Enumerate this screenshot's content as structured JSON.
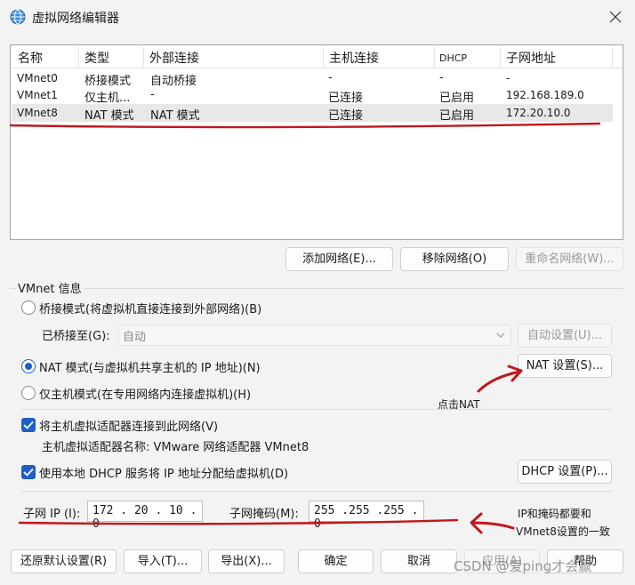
{
  "window": {
    "title": "虚拟网络编辑器",
    "icon": "network-globe-icon",
    "close_icon": "close-icon"
  },
  "table": {
    "columns": [
      "名称",
      "类型",
      "外部连接",
      "主机连接",
      "DHCP",
      "子网地址"
    ],
    "rows": [
      {
        "name": "VMnet0",
        "type": "桥接模式",
        "external": "自动桥接",
        "host": "-",
        "dhcp": "-",
        "subnet": "-"
      },
      {
        "name": "VMnet1",
        "type": "仅主机...",
        "external": "-",
        "host": "已连接",
        "dhcp": "已启用",
        "subnet": "192.168.189.0"
      },
      {
        "name": "VMnet8",
        "type": "NAT 模式",
        "external": "NAT 模式",
        "host": "已连接",
        "dhcp": "已启用",
        "subnet": "172.20.10.0"
      }
    ],
    "selected_row": "VMnet8"
  },
  "network_buttons": {
    "add": "添加网络(E)...",
    "remove": "移除网络(O)",
    "rename": "重命名网络(W)..."
  },
  "vmnet_info": {
    "group_label": "VMnet 信息",
    "bridge_radio": "桥接模式(将虚拟机直接连接到外部网络)(B)",
    "bridged_to_label": "已桥接至(G):",
    "bridged_to_value": "自动",
    "auto_settings": "自动设置(U)...",
    "nat_radio": "NAT 模式(与虚拟机共享主机的 IP 地址)(N)",
    "nat_settings": "NAT 设置(S)...",
    "host_only_radio": "仅主机模式(在专用网络内连接虚拟机)(H)",
    "selected_mode": "nat",
    "connect_adapter": "将主机虚拟适配器连接到此网络(V)",
    "connect_adapter_checked": true,
    "adapter_name": "主机虚拟适配器名称: VMware 网络适配器 VMnet8",
    "use_dhcp": "使用本地 DHCP 服务将 IP 地址分配给虚拟机(D)",
    "use_dhcp_checked": true,
    "dhcp_settings": "DHCP 设置(P)...",
    "subnet_ip_label": "子网 IP (I):",
    "subnet_ip_value": "172 . 20 . 10 . 0",
    "subnet_mask_label": "子网掩码(M):",
    "subnet_mask_value": "255 .255 .255 . 0"
  },
  "footer": {
    "restore": "还原默认设置(R)",
    "import": "导入(T)...",
    "export": "导出(X)...",
    "ok": "确定",
    "cancel": "取消",
    "apply": "应用(A)",
    "help": "帮助"
  },
  "annotations": {
    "click_nat": "点击NAT",
    "ip_note_line1": "IP和掩码都要和",
    "ip_note_line2": "VMnet8设置的一致",
    "annotation_color": "#c0171c"
  },
  "watermark": "CSDN @爱ping才会赢",
  "colors": {
    "accent": "#1f5ec7",
    "window_bg": "#f3f3f3",
    "selection": "#e8e8e8"
  }
}
